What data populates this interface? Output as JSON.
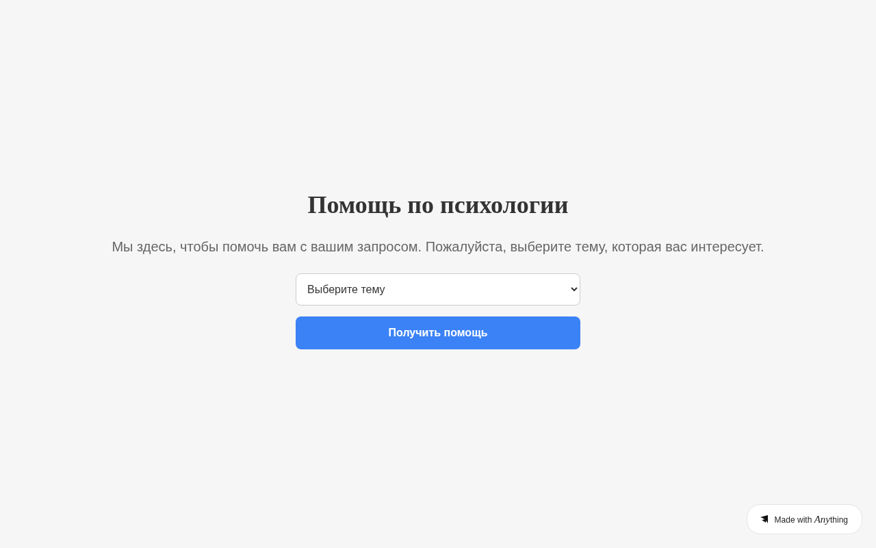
{
  "heading": "Помощь по психологии",
  "intro": "Мы здесь, чтобы помочь вам с вашим запросом. Пожалуйста, выберите тему, которая вас интересует.",
  "topic_select": {
    "value": "Выберите тему"
  },
  "submit_button": "Получить помощь",
  "badge": {
    "prefix": "Made with",
    "brand_italic": "Any",
    "brand_rest": "thing"
  }
}
